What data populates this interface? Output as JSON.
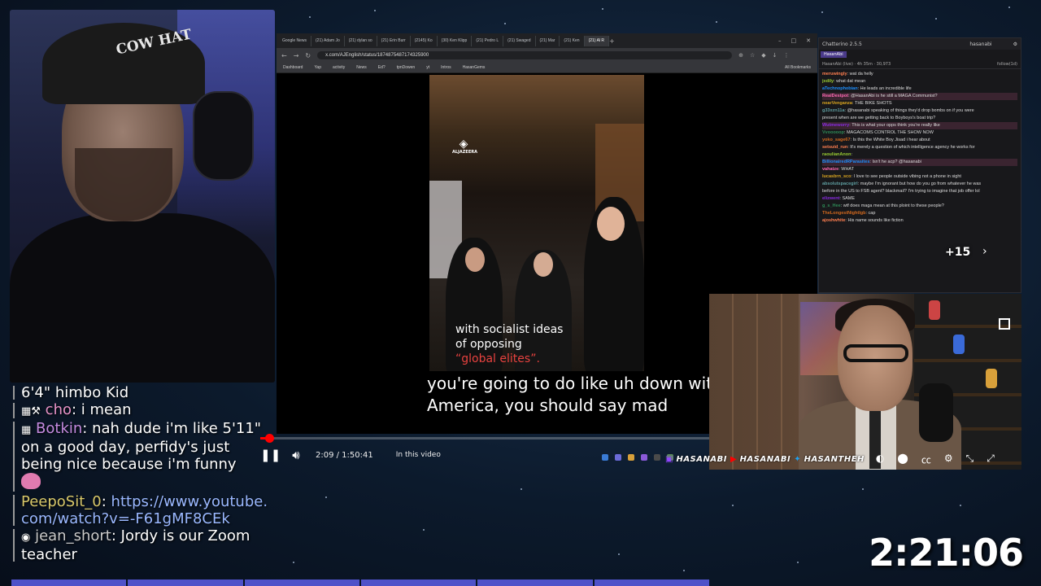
{
  "webcam": {
    "hat_text": "COW HAT"
  },
  "browser": {
    "tabs": [
      "Google News",
      "(21) Adam Jo",
      "(21) dylan so",
      "(21) Erin Burr",
      "(2145) Ko",
      "(30) Ken Klipp",
      "(21) Pedro L",
      "(21) Swaged",
      "(21) Mar",
      "(21) Ken",
      "(21) Al R"
    ],
    "url": "x.com/AJEnglish/status/1874875487174325900",
    "bookmarks": [
      "Dashboard",
      "Yap",
      "activity",
      "News",
      "Ed?",
      "tpnDowen",
      "yt",
      "Intros",
      "HasanGems"
    ],
    "all_bookmarks": "All Bookmarks"
  },
  "reel": {
    "logo": "ALJAZEERA",
    "caption_line1": "with socialist ideas",
    "caption_line2": "of opposing",
    "caption_highlight": "“global elites”."
  },
  "caption": {
    "line1": "you're going to do like uh down with",
    "line2": "America, you should say mad"
  },
  "player": {
    "time": "2:09 / 1:50:41",
    "in_video": "In this video",
    "progress": 0.0195
  },
  "chatwin": {
    "app": "Chatterino 2.5.5",
    "user": "hasanabi",
    "tab": "HasanAbi",
    "info": "HasanAbi (live) · 4h 35m · 30,973",
    "follow": "follow(1d)",
    "messages": [
      {
        "u": "meruwingly",
        "t": "wat da helly",
        "hi": false
      },
      {
        "u": "jxdily",
        "t": "what dat mean",
        "hi": false
      },
      {
        "u": "aTechnophobian",
        "t": "He leads an incredible life",
        "hi": false
      },
      {
        "u": "RealDestpot",
        "t": "@HasanAbi is he still a MAGA Communist?",
        "hi": true
      },
      {
        "u": "nearVenganza",
        "t": "THE BIKE SHOTS",
        "hi": false
      },
      {
        "u": "g33xzn11a",
        "t": "@hasanabi speaking of things they'd drop bombs on if you were",
        "hi": false
      },
      {
        "u": "",
        "t": "present when are we getting back to Boyboys's boat trip?",
        "hi": false
      },
      {
        "u": "Wutmeworry",
        "t": "This is what your opps think you're really like",
        "hi": true
      },
      {
        "u": "Vvooooop",
        "t": "MAGACOMS CONTROL THE SHOW NOW",
        "hi": false
      },
      {
        "u": "yoko_sage67",
        "t": "Is this the White Boy Jisad i hear about",
        "hi": false
      },
      {
        "u": "setsuid_run",
        "t": "It's merely a question of which intelligence agency he works for",
        "hi": false
      },
      {
        "u": "raoulianAnon",
        "t": "",
        "hi": false
      },
      {
        "u": "BillionairedRParasites",
        "t": "Isn't he acp? @hasanabi",
        "hi": true
      },
      {
        "u": "vahatze",
        "t": "WHAT",
        "hi": false
      },
      {
        "u": "lucasbrn_sco",
        "t": "I love to see people outside vibing not a phone in sight",
        "hi": false
      },
      {
        "u": "absolutspacegirl",
        "t": "maybe I'm ignorant but how do you go from whatever he was",
        "hi": false
      },
      {
        "u": "",
        "t": "before in the US to FSB agent? blackmail? I'm trying to imagine that job offer lol",
        "hi": false
      },
      {
        "u": "elizwent",
        "t": "SAME",
        "hi": false
      },
      {
        "u": "g_s_Hee",
        "t": "wtf does maga mean at this ploint to these people?",
        "hi": false
      },
      {
        "u": "TheLongestNightIgb",
        "t": "cap",
        "hi": false
      },
      {
        "u": "ajoshwhite",
        "t": "His name sounds like fiction",
        "hi": false
      }
    ],
    "overflow": "+15"
  },
  "cam2": {
    "socials": [
      "HASANABI",
      "HASANABI",
      "HASANTHEH"
    ]
  },
  "left_chat": [
    {
      "user": "",
      "text": "6'4\" himbo Kid",
      "color": "#ffffff"
    },
    {
      "user": "cho",
      "sep": ": ",
      "text": "i mean"
    },
    {
      "user": "Botkin",
      "sep": ": ",
      "text": "nah dude i'm like 5'11\" on a good day, perfidy's just being nice because i'm funny"
    },
    {
      "user": "PeepoSit_0",
      "sep": ": ",
      "text": "https://www.youtube.com/watch?v=-F61gMF8CEk"
    },
    {
      "user": "jean_short",
      "sep": ": ",
      "text": "Jordy is our Zoom teacher"
    }
  ],
  "clock": "2:21:06",
  "colors": {
    "accent": "#ff0000",
    "strip": "#4f52c9"
  }
}
